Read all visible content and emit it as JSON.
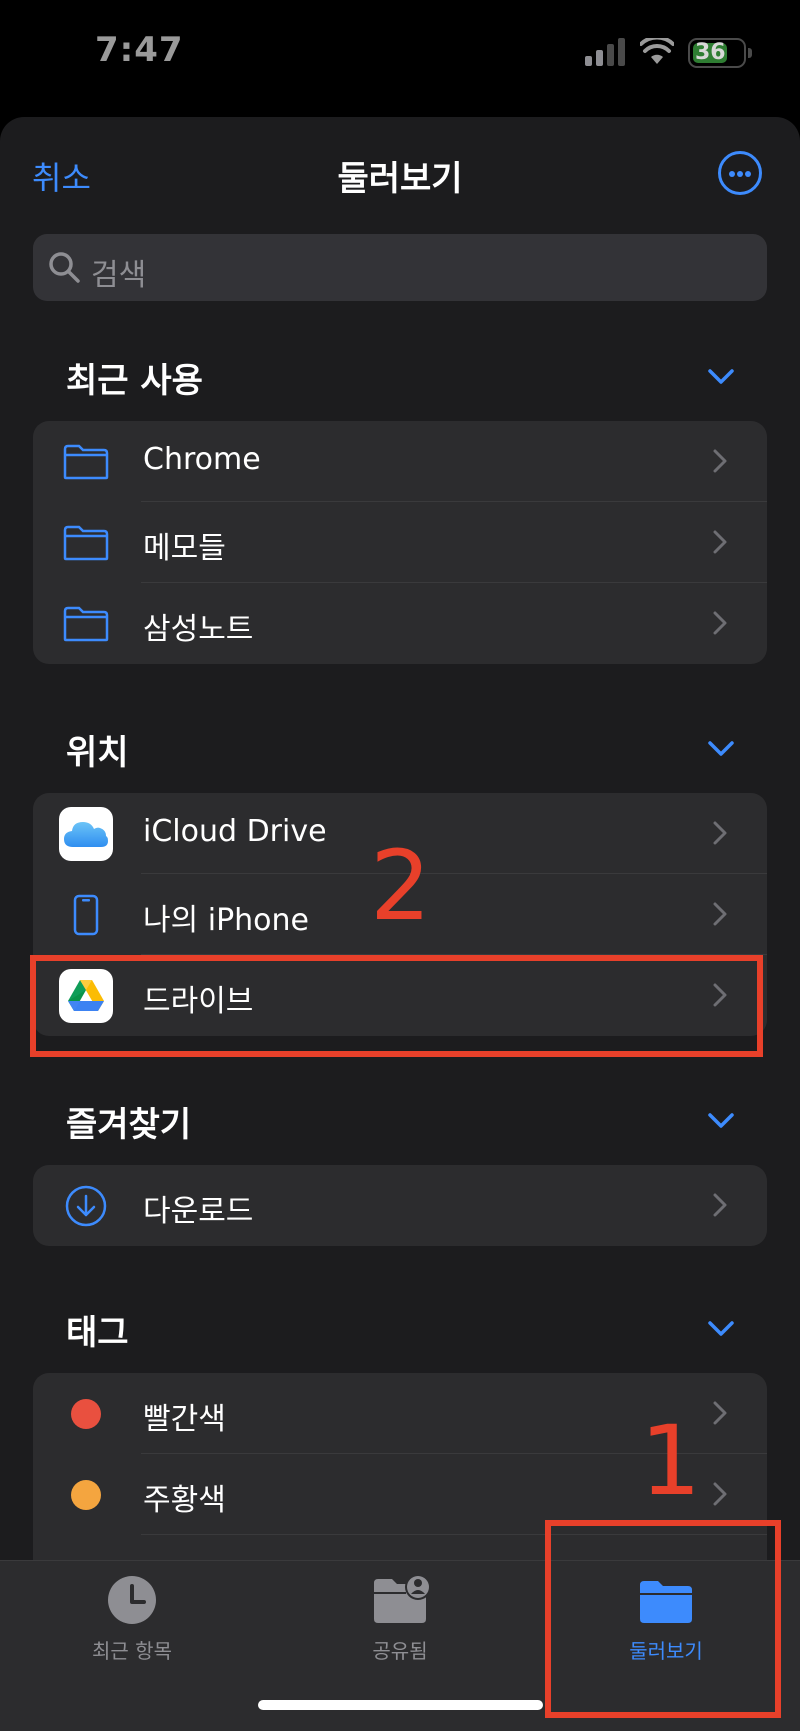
{
  "status_bar": {
    "time": "7:47",
    "battery": "36"
  },
  "header": {
    "cancel_label": "취소",
    "title": "둘러보기",
    "more_icon": "ellipsis-circle-icon"
  },
  "search": {
    "placeholder": "검색"
  },
  "sections": {
    "recent": {
      "title": "최근 사용",
      "items": [
        {
          "label": "Chrome",
          "icon": "folder-icon"
        },
        {
          "label": "메모들",
          "icon": "folder-icon"
        },
        {
          "label": "삼성노트",
          "icon": "folder-icon"
        }
      ]
    },
    "locations": {
      "title": "위치",
      "items": [
        {
          "label": "iCloud Drive",
          "icon": "icloud-icon"
        },
        {
          "label": "나의 iPhone",
          "icon": "iphone-icon"
        },
        {
          "label": "드라이브",
          "icon": "google-drive-icon"
        }
      ]
    },
    "favorites": {
      "title": "즐겨찾기",
      "items": [
        {
          "label": "다운로드",
          "icon": "download-icon"
        }
      ]
    },
    "tags": {
      "title": "태그",
      "items": [
        {
          "label": "빨간색",
          "color": "#e9503f"
        },
        {
          "label": "주황색",
          "color": "#f4a53f"
        }
      ]
    }
  },
  "annotations": {
    "first": "1",
    "second": "2",
    "color": "#e8402a"
  },
  "tabbar": {
    "tabs": [
      {
        "label": "최근 항목",
        "icon": "clock-icon",
        "active": false
      },
      {
        "label": "공유됨",
        "icon": "shared-folder-icon",
        "active": false
      },
      {
        "label": "둘러보기",
        "icon": "folder-fill-icon",
        "active": true
      }
    ]
  },
  "colors": {
    "accent": "#3d8bfd",
    "background": "#1c1c1e",
    "cell": "#2c2c2e"
  }
}
